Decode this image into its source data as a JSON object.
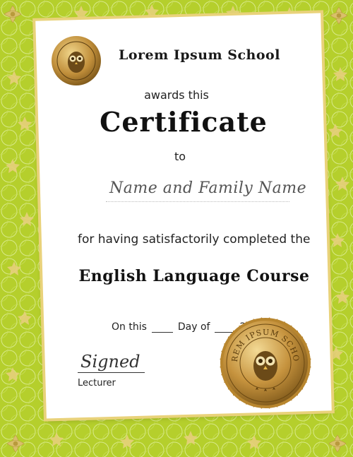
{
  "certificate": {
    "school": "Lorem Ipsum School",
    "awards": "awards this",
    "title": "Certificate",
    "to": "to",
    "recipient": "Name and Family Name",
    "completed": "for having satisfactorily completed the",
    "course": "English Language Course",
    "date": {
      "on_this": "On this",
      "day_of": "Day of",
      "year": "20"
    },
    "signed": "Signed",
    "lecturer": "Lecturer"
  },
  "seal": {
    "text": "LOREM IPSUM SCHOOL"
  },
  "colors": {
    "border_green": "#b5cf2c",
    "gold": "#c9a04b",
    "paper": "#ffffff"
  }
}
